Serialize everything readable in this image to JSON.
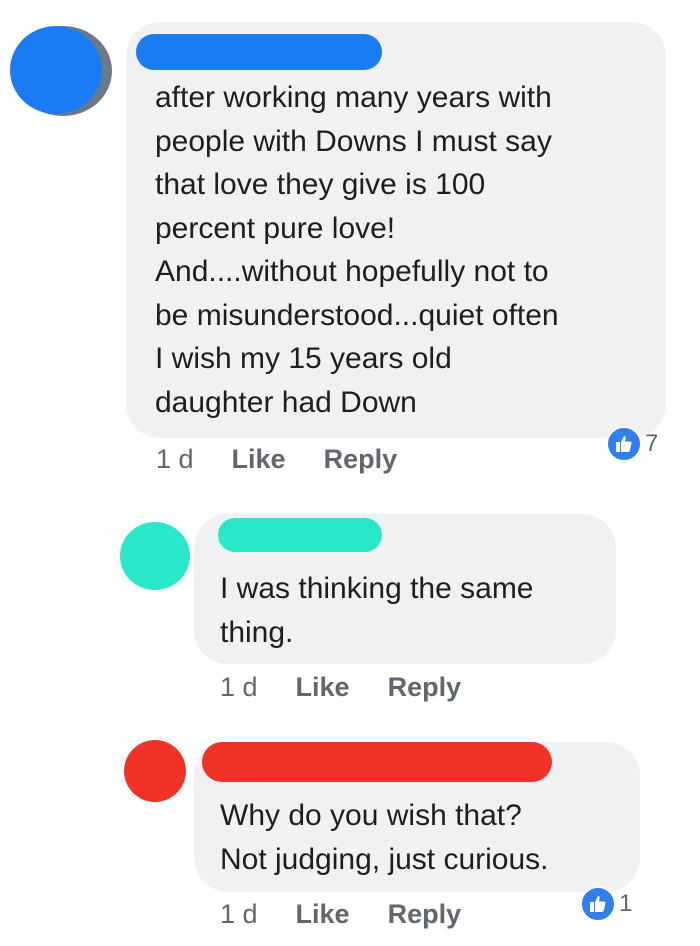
{
  "colors": {
    "bubble": "#f0f1f3",
    "text": "#1c1e21",
    "meta": "#606770",
    "like_blue": "#2f80ed",
    "redact_blue": "#1a7cf5",
    "redact_teal": "#29e8c8",
    "redact_red": "#ef3326"
  },
  "comments": [
    {
      "body": "after working many years with\npeople with Downs I must say\nthat love they give is 100\npercent pure love!\nAnd....without hopefully not to\nbe misunderstood...quiet often\nI wish my 15 years old\ndaughter had Down",
      "time": "1 d",
      "like": "Like",
      "reply": "Reply",
      "reactions": "7",
      "reaction_icon": "thumbs-up-icon"
    },
    {
      "body": "I was thinking the same\nthing.",
      "time": "1 d",
      "like": "Like",
      "reply": "Reply"
    },
    {
      "body": "Why do you wish that?\nNot judging, just curious.",
      "time": "1 d",
      "like": "Like",
      "reply": "Reply",
      "reactions": "1",
      "reaction_icon": "thumbs-up-icon"
    }
  ]
}
